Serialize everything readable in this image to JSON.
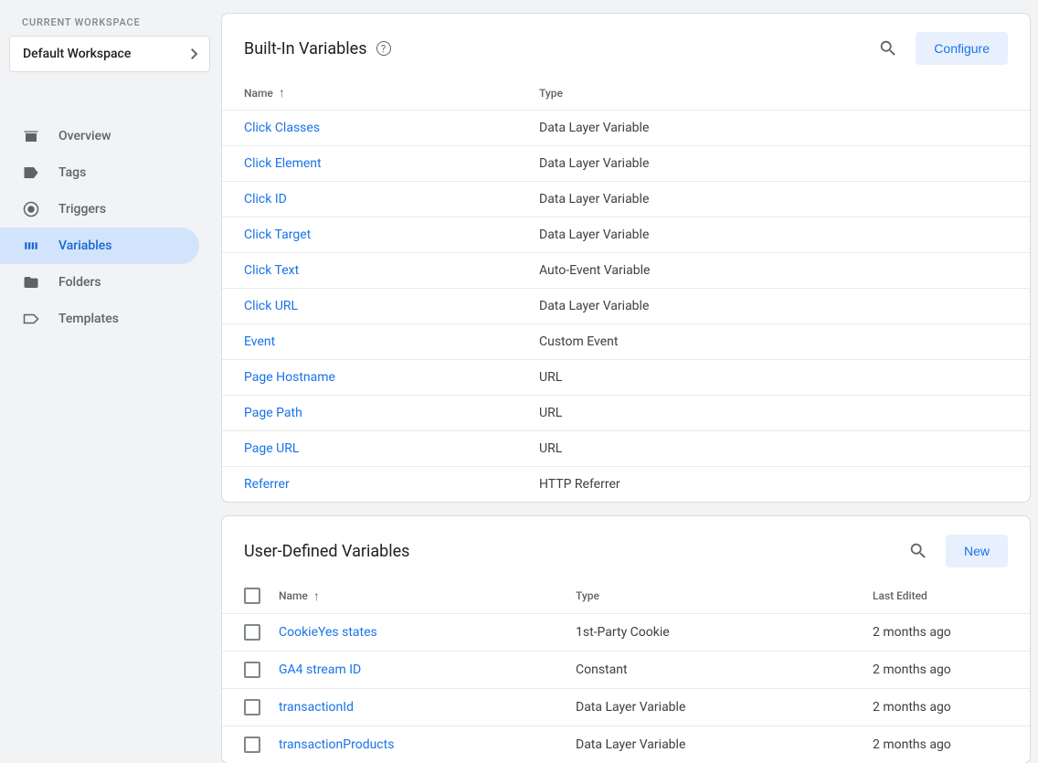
{
  "sidebar": {
    "workspace_label": "CURRENT WORKSPACE",
    "workspace_value": "Default Workspace",
    "nav": [
      {
        "label": "Overview",
        "icon": "overview"
      },
      {
        "label": "Tags",
        "icon": "tag"
      },
      {
        "label": "Triggers",
        "icon": "trigger"
      },
      {
        "label": "Variables",
        "icon": "variable",
        "active": true
      },
      {
        "label": "Folders",
        "icon": "folder"
      },
      {
        "label": "Templates",
        "icon": "template"
      }
    ]
  },
  "builtin": {
    "title": "Built-In Variables",
    "configure_label": "Configure",
    "columns": {
      "name": "Name",
      "type": "Type"
    },
    "rows": [
      {
        "name": "Click Classes",
        "type": "Data Layer Variable"
      },
      {
        "name": "Click Element",
        "type": "Data Layer Variable"
      },
      {
        "name": "Click ID",
        "type": "Data Layer Variable"
      },
      {
        "name": "Click Target",
        "type": "Data Layer Variable"
      },
      {
        "name": "Click Text",
        "type": "Auto-Event Variable"
      },
      {
        "name": "Click URL",
        "type": "Data Layer Variable"
      },
      {
        "name": "Event",
        "type": "Custom Event"
      },
      {
        "name": "Page Hostname",
        "type": "URL"
      },
      {
        "name": "Page Path",
        "type": "URL"
      },
      {
        "name": "Page URL",
        "type": "URL"
      },
      {
        "name": "Referrer",
        "type": "HTTP Referrer"
      }
    ]
  },
  "user": {
    "title": "User-Defined Variables",
    "new_label": "New",
    "columns": {
      "name": "Name",
      "type": "Type",
      "edited": "Last Edited"
    },
    "rows": [
      {
        "name": "CookieYes states",
        "type": "1st-Party Cookie",
        "edited": "2 months ago"
      },
      {
        "name": "GA4 stream ID",
        "type": "Constant",
        "edited": "2 months ago"
      },
      {
        "name": "transactionId",
        "type": "Data Layer Variable",
        "edited": "2 months ago"
      },
      {
        "name": "transactionProducts",
        "type": "Data Layer Variable",
        "edited": "2 months ago"
      }
    ]
  }
}
